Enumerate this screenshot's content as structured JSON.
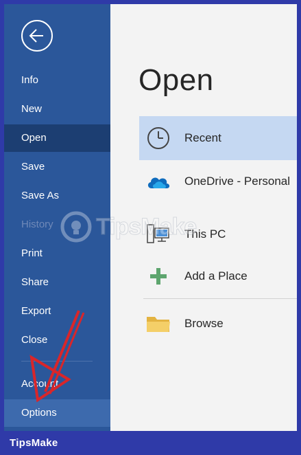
{
  "sidebar": {
    "items": [
      {
        "label": "Info"
      },
      {
        "label": "New"
      },
      {
        "label": "Open"
      },
      {
        "label": "Save"
      },
      {
        "label": "Save As"
      },
      {
        "label": "History"
      },
      {
        "label": "Print"
      },
      {
        "label": "Share"
      },
      {
        "label": "Export"
      },
      {
        "label": "Close"
      },
      {
        "label": "Account"
      },
      {
        "label": "Options"
      }
    ]
  },
  "main": {
    "title": "Open",
    "locations": [
      {
        "label": "Recent",
        "icon": "clock-icon"
      },
      {
        "label": "OneDrive - Personal",
        "icon": "onedrive-cloud-icon"
      },
      {
        "label": "This PC",
        "icon": "computer-icon"
      },
      {
        "label": "Add a Place",
        "icon": "plus-icon"
      },
      {
        "label": "Browse",
        "icon": "folder-icon"
      }
    ]
  },
  "watermark": {
    "text": "TipsMake"
  },
  "footer": {
    "brand": "TipsMake"
  },
  "colors": {
    "sidebar": "#2b579a",
    "sidebar_active": "#1c3e72",
    "selected_location": "#c5d8f2",
    "frame_border": "#2f3aa8",
    "annotation_arrow": "#d9262a"
  }
}
